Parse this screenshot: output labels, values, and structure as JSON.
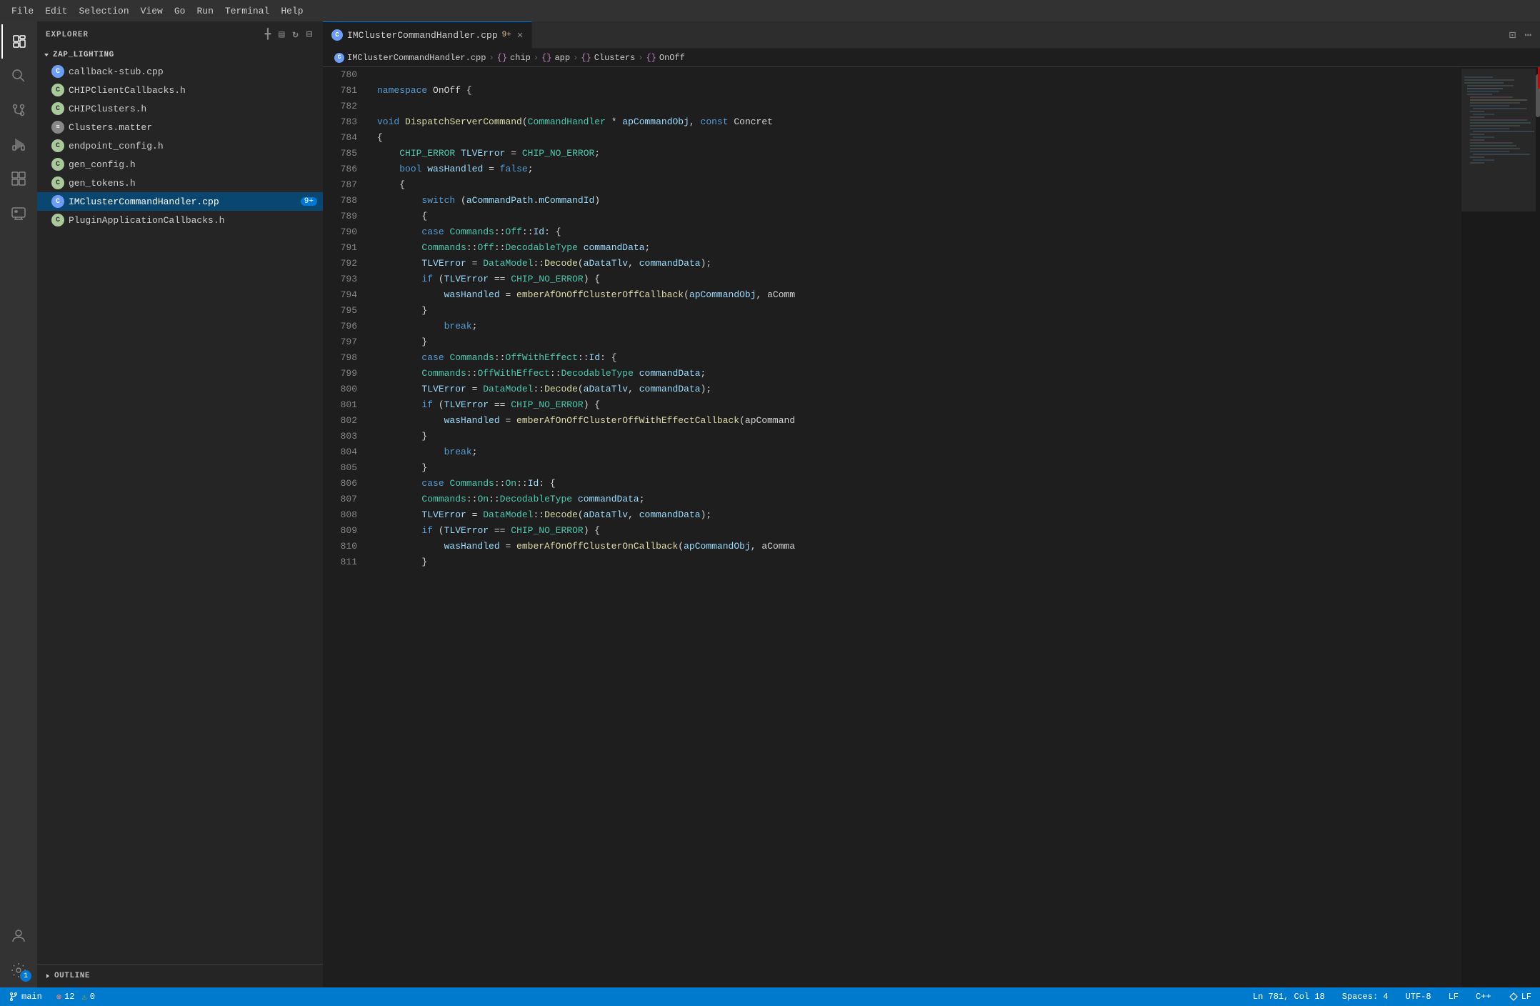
{
  "menuBar": {
    "items": [
      "File",
      "Edit",
      "Selection",
      "View",
      "Go",
      "Run",
      "Terminal",
      "Help"
    ]
  },
  "activityBar": {
    "icons": [
      {
        "name": "explorer-icon",
        "symbol": "⬜",
        "active": true
      },
      {
        "name": "search-icon",
        "symbol": "🔍",
        "active": false
      },
      {
        "name": "source-control-icon",
        "symbol": "⎇",
        "active": false
      },
      {
        "name": "run-debug-icon",
        "symbol": "▷",
        "active": false
      },
      {
        "name": "extensions-icon",
        "symbol": "⊞",
        "active": false
      },
      {
        "name": "remote-explorer-icon",
        "symbol": "🖥",
        "active": false
      },
      {
        "name": "source-icon",
        "symbol": "↺",
        "active": false
      }
    ],
    "bottomIcons": [
      {
        "name": "account-icon",
        "symbol": "👤"
      },
      {
        "name": "settings-icon",
        "symbol": "⚙",
        "badge": "1"
      }
    ]
  },
  "sidebar": {
    "title": "EXPLORER",
    "workspaceTitle": "ZAP_LIGHTING",
    "files": [
      {
        "name": "callback-stub.cpp",
        "type": "cpp",
        "label": "C",
        "active": false
      },
      {
        "name": "CHIPClientCallbacks.h",
        "type": "h",
        "label": "C",
        "active": false
      },
      {
        "name": "CHIPClusters.h",
        "type": "h",
        "label": "C",
        "active": false
      },
      {
        "name": "Clusters.matter",
        "type": "matter",
        "label": "≡",
        "active": false
      },
      {
        "name": "endpoint_config.h",
        "type": "h",
        "label": "C",
        "active": false
      },
      {
        "name": "gen_config.h",
        "type": "h",
        "label": "C",
        "active": false
      },
      {
        "name": "gen_tokens.h",
        "type": "h",
        "label": "C",
        "active": false
      },
      {
        "name": "IMClusterCommandHandler.cpp",
        "type": "cpp",
        "label": "C",
        "active": true,
        "badge": "9+"
      },
      {
        "name": "PluginApplicationCallbacks.h",
        "type": "h",
        "label": "C",
        "active": false
      }
    ],
    "outline": {
      "label": "OUTLINE"
    }
  },
  "tabs": [
    {
      "name": "IMClusterCommandHandler.cpp",
      "icon": "C",
      "modified": true,
      "badge": "9+",
      "active": true
    }
  ],
  "breadcrumb": {
    "filename": "IMClusterCommandHandler.cpp",
    "path": [
      "chip",
      "app",
      "Clusters",
      "OnOff"
    ]
  },
  "editor": {
    "startLine": 780,
    "lines": [
      {
        "num": 780,
        "content": ""
      },
      {
        "num": 781,
        "content": "namespace OnOff {"
      },
      {
        "num": 782,
        "content": ""
      },
      {
        "num": 783,
        "content": "void DispatchServerCommand(CommandHandler * apCommandObj, const Concret"
      },
      {
        "num": 784,
        "content": "{"
      },
      {
        "num": 785,
        "content": "    CHIP_ERROR TLVError = CHIP_NO_ERROR;"
      },
      {
        "num": 786,
        "content": "    bool wasHandled = false;"
      },
      {
        "num": 787,
        "content": "{"
      },
      {
        "num": 788,
        "content": "        switch (aCommandPath.mCommandId)"
      },
      {
        "num": 789,
        "content": "        {"
      },
      {
        "num": 790,
        "content": "        case Commands::Off::Id: {"
      },
      {
        "num": 791,
        "content": "        Commands::Off::DecodableType commandData;"
      },
      {
        "num": 792,
        "content": "        TLVError = DataModel::Decode(aDataTlv, commandData);"
      },
      {
        "num": 793,
        "content": "        if (TLVError == CHIP_NO_ERROR) {"
      },
      {
        "num": 794,
        "content": "            wasHandled = emberAfOnOffClusterOffCallback(apCommandObj, aComm"
      },
      {
        "num": 795,
        "content": "        }"
      },
      {
        "num": 796,
        "content": "            break;"
      },
      {
        "num": 797,
        "content": "        }"
      },
      {
        "num": 798,
        "content": "        case Commands::OffWithEffect::Id: {"
      },
      {
        "num": 799,
        "content": "        Commands::OffWithEffect::DecodableType commandData;"
      },
      {
        "num": 800,
        "content": "        TLVError = DataModel::Decode(aDataTlv, commandData);"
      },
      {
        "num": 801,
        "content": "        if (TLVError == CHIP_NO_ERROR) {"
      },
      {
        "num": 802,
        "content": "            wasHandled = emberAfOnOffClusterOffWithEffectCallback(apCommand"
      },
      {
        "num": 803,
        "content": "        }"
      },
      {
        "num": 804,
        "content": "            break;"
      },
      {
        "num": 805,
        "content": "        }"
      },
      {
        "num": 806,
        "content": "        case Commands::On::Id: {"
      },
      {
        "num": 807,
        "content": "        Commands::On::DecodableType commandData;"
      },
      {
        "num": 808,
        "content": "        TLVError = DataModel::Decode(aDataTlv, commandData);"
      },
      {
        "num": 809,
        "content": "        if (TLVError == CHIP_NO_ERROR) {"
      },
      {
        "num": 810,
        "content": "            wasHandled = emberAfOnOffClusterOnCallback(apCommandObj, aComma"
      },
      {
        "num": 811,
        "content": "        }"
      }
    ]
  },
  "statusBar": {
    "branch": "main",
    "errors": "12",
    "warnings": "0",
    "position": "Ln 781, Col 18",
    "spaces": "Spaces: 4",
    "encoding": "UTF-8",
    "lineEnding": "LF",
    "language": "C++",
    "errorIcon": "⊗",
    "warningIcon": "⚠"
  }
}
